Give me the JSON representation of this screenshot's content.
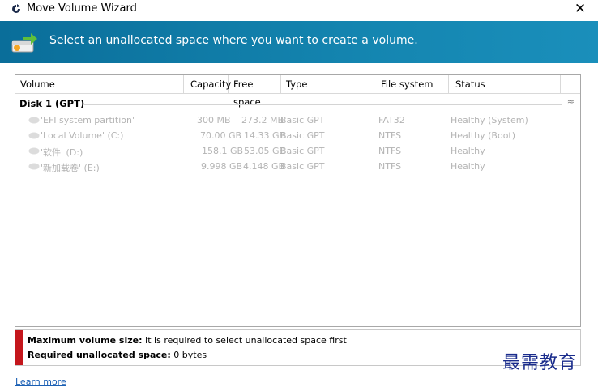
{
  "window": {
    "title": "Move Volume Wizard",
    "close_glyph": "✕"
  },
  "banner": {
    "text": "Select an unallocated space where you want to create a volume.",
    "icon": "disk-arrow-icon"
  },
  "table": {
    "columns": [
      "Volume",
      "Capacity",
      "Free space",
      "Type",
      "File system",
      "Status"
    ],
    "disk_label": "Disk 1 (GPT)",
    "collapse_glyph": "≈",
    "rows": [
      {
        "volume": "'EFI system partition'",
        "capacity": "300 MB",
        "free": "273.2 MB",
        "type": "Basic GPT",
        "fs": "FAT32",
        "status": "Healthy (System)"
      },
      {
        "volume": "'Local Volume' (C:)",
        "capacity": "70.00 GB",
        "free": "14.33 GB",
        "type": "Basic GPT",
        "fs": "NTFS",
        "status": "Healthy (Boot)"
      },
      {
        "volume": "'软件' (D:)",
        "capacity": "158.1 GB",
        "free": "53.05 GB",
        "type": "Basic GPT",
        "fs": "NTFS",
        "status": "Healthy"
      },
      {
        "volume": "'新加载卷' (E:)",
        "capacity": "9.998 GB",
        "free": "4.148 GB",
        "type": "Basic GPT",
        "fs": "NTFS",
        "status": "Healthy"
      }
    ]
  },
  "info": {
    "max_label": "Maximum volume size:",
    "max_value": "It is required to select unallocated space first",
    "req_label": "Required unallocated space:",
    "req_value": "0 bytes"
  },
  "learn_more": "Learn more",
  "watermark": "最需教育",
  "colors": {
    "banner": "#1485b0",
    "error_bar": "#c4161c",
    "link": "#1a5fb4"
  }
}
